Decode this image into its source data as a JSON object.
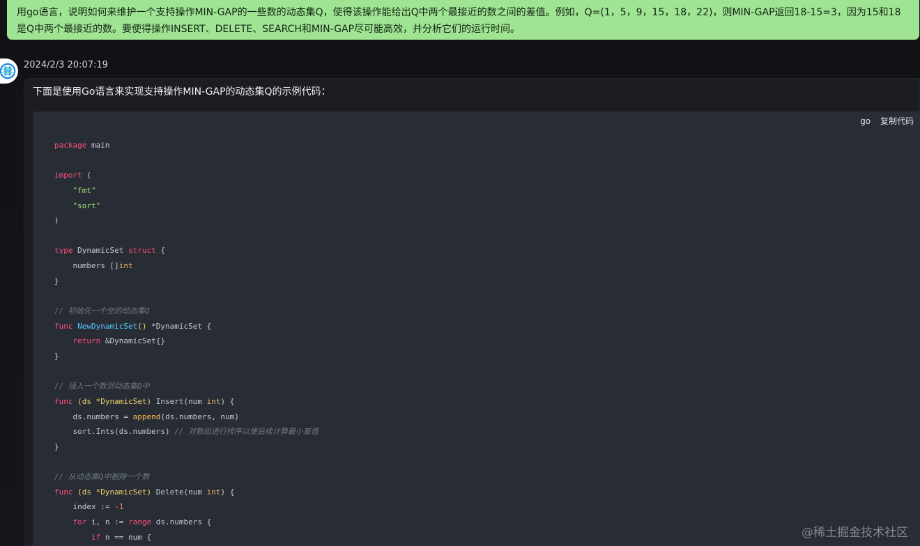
{
  "question": {
    "text": "用go语言，说明如何来维护一个支持操作MIN-GAP的一些数的动态集Q，使得该操作能给出Q中两个最接近的数之间的差值。例如，Q=(1，5，9，15，18，22)，则MIN-GAP返回18-15=3，因为15和18是Q中两个最接近的数。要使得操作INSERT、DELETE、SEARCH和MIN-GAP尽可能高效，并分析它们的运行时间。"
  },
  "assistant": {
    "timestamp": "2024/2/3 20:07:19",
    "intro": "下面是使用Go语言来实现支持操作MIN-GAP的动态集Q的示例代码："
  },
  "code_block": {
    "language": "go",
    "copy_label": "复制代码",
    "lines": [
      [
        {
          "text": "package",
          "kind": "kw"
        },
        {
          "text": " main",
          "kind": "plain"
        }
      ],
      [],
      [
        {
          "text": "import",
          "kind": "kw"
        },
        {
          "text": " (",
          "kind": "plain"
        }
      ],
      [
        {
          "text": "    ",
          "kind": "plain"
        },
        {
          "text": "\"fmt\"",
          "kind": "str"
        }
      ],
      [
        {
          "text": "    ",
          "kind": "plain"
        },
        {
          "text": "\"sort\"",
          "kind": "str"
        }
      ],
      [
        {
          "text": ")",
          "kind": "plain"
        }
      ],
      [],
      [
        {
          "text": "type",
          "kind": "kw"
        },
        {
          "text": " DynamicSet ",
          "kind": "plain"
        },
        {
          "text": "struct",
          "kind": "kw"
        },
        {
          "text": " {",
          "kind": "plain"
        }
      ],
      [
        {
          "text": "    numbers []",
          "kind": "plain"
        },
        {
          "text": "int",
          "kind": "ty"
        }
      ],
      [
        {
          "text": "}",
          "kind": "plain"
        }
      ],
      [],
      [
        {
          "text": "// 初始化一个空的动态集Q",
          "kind": "com"
        }
      ],
      [
        {
          "text": "func",
          "kind": "kw"
        },
        {
          "text": " ",
          "kind": "plain"
        },
        {
          "text": "NewDynamicSet",
          "kind": "fn"
        },
        {
          "text": "()",
          "kind": "param"
        },
        {
          "text": " *DynamicSet {",
          "kind": "plain"
        }
      ],
      [
        {
          "text": "    ",
          "kind": "plain"
        },
        {
          "text": "return",
          "kind": "kw"
        },
        {
          "text": " &DynamicSet{}",
          "kind": "plain"
        }
      ],
      [
        {
          "text": "}",
          "kind": "plain"
        }
      ],
      [],
      [
        {
          "text": "// 插入一个数到动态集Q中",
          "kind": "com"
        }
      ],
      [
        {
          "text": "func",
          "kind": "kw"
        },
        {
          "text": " ",
          "kind": "plain"
        },
        {
          "text": "(ds *DynamicSet)",
          "kind": "param"
        },
        {
          "text": " Insert(num ",
          "kind": "plain"
        },
        {
          "text": "int",
          "kind": "ty"
        },
        {
          "text": ") {",
          "kind": "plain"
        }
      ],
      [
        {
          "text": "    ds.numbers = ",
          "kind": "plain"
        },
        {
          "text": "append",
          "kind": "builtin"
        },
        {
          "text": "(ds.numbers, num)",
          "kind": "plain"
        }
      ],
      [
        {
          "text": "    sort.Ints(ds.numbers) ",
          "kind": "plain"
        },
        {
          "text": "// 对数组进行排序以便后续计算最小差值",
          "kind": "com"
        }
      ],
      [
        {
          "text": "}",
          "kind": "plain"
        }
      ],
      [],
      [
        {
          "text": "// 从动态集Q中删除一个数",
          "kind": "com"
        }
      ],
      [
        {
          "text": "func",
          "kind": "kw"
        },
        {
          "text": " ",
          "kind": "plain"
        },
        {
          "text": "(ds *DynamicSet)",
          "kind": "param"
        },
        {
          "text": " Delete(num ",
          "kind": "plain"
        },
        {
          "text": "int",
          "kind": "ty"
        },
        {
          "text": ") {",
          "kind": "plain"
        }
      ],
      [
        {
          "text": "    index := ",
          "kind": "plain"
        },
        {
          "text": "-1",
          "kind": "num"
        }
      ],
      [
        {
          "text": "    ",
          "kind": "plain"
        },
        {
          "text": "for",
          "kind": "kw"
        },
        {
          "text": " i, n := ",
          "kind": "plain"
        },
        {
          "text": "range",
          "kind": "kw"
        },
        {
          "text": " ds.numbers {",
          "kind": "plain"
        }
      ],
      [
        {
          "text": "        ",
          "kind": "plain"
        },
        {
          "text": "if",
          "kind": "kw"
        },
        {
          "text": " n == num {",
          "kind": "plain"
        }
      ]
    ]
  },
  "watermark": {
    "text": "@稀土掘金技术社区"
  },
  "colors": {
    "user_bubble": "#9ee492",
    "code_background": "#282c34",
    "keyword": "#ff4f7b",
    "string": "#9ee275",
    "type": "#e8b56c",
    "function": "#55c8ff",
    "comment": "#6f7884"
  },
  "icons": {
    "avatar": "assistant-logo-icon"
  }
}
